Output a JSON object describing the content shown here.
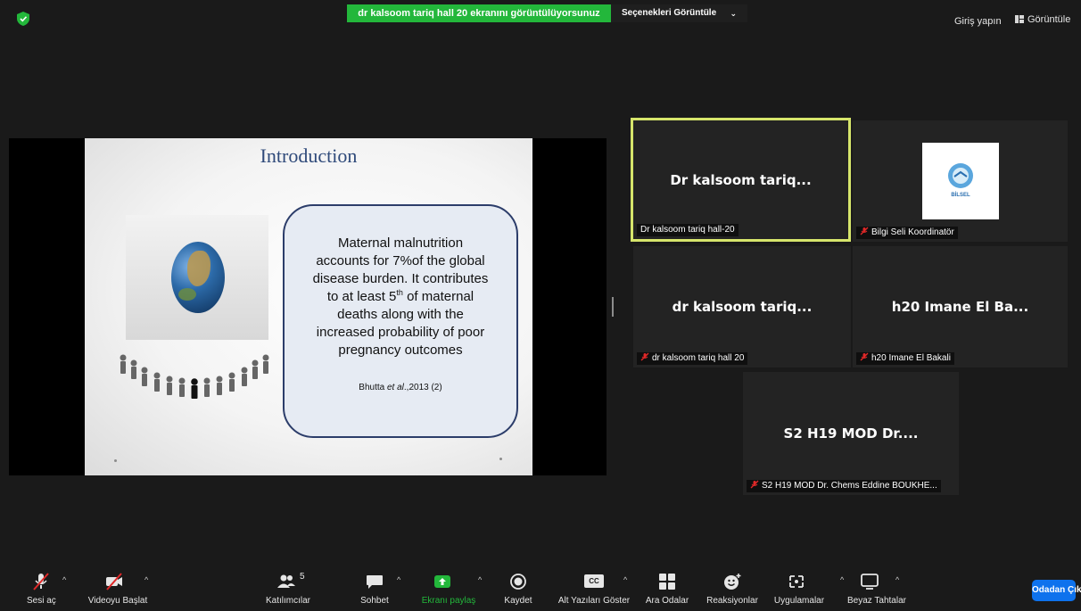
{
  "top_bar": {
    "share_banner": "dr kalsoom tariq hall  20 ekranını görüntülüyorsunuz",
    "view_options": "Seçenekleri Görüntüle",
    "sign_in": "Giriş yapın",
    "view": "Görüntüle",
    "colors": {
      "banner": "#23b73b",
      "shield": "#23b73b"
    }
  },
  "slide": {
    "title": "Introduction",
    "body_line1": "Maternal malnutrition",
    "body_line2": "accounts for 7%of the global",
    "body_line3": "disease burden.  It contributes",
    "body_line4_pre": "to at least  5",
    "body_line4_sup": "th",
    "body_line4_post": "  of maternal",
    "body_line5": "deaths along with the",
    "body_line6": "increased probability of poor",
    "body_line7": "pregnancy outcomes",
    "citation_pre": "Bhutta ",
    "citation_ital": "et al",
    "citation_post": ".,2013 (2)"
  },
  "participants": [
    {
      "display_name": "Dr kalsoom tariq...",
      "label": "Dr kalsoom tariq hall-20",
      "muted": false,
      "active_speaker": true
    },
    {
      "display_name": "",
      "label": "Bilgi Seli Koordinatör",
      "muted": true,
      "logo_text": "BİLSEL"
    },
    {
      "display_name": "dr kalsoom tariq...",
      "label": "dr kalsoom tariq hall  20",
      "muted": true
    },
    {
      "display_name": "h20 Imane El Ba...",
      "label": "h20 Imane El Bakali",
      "muted": true
    },
    {
      "display_name": "S2 H19 MOD Dr....",
      "label": "S2 H19 MOD Dr. Chems Eddine BOUKHE...",
      "muted": true
    }
  ],
  "toolbar": {
    "unmute": "Sesi aç",
    "start_video": "Videoyu Başlat",
    "participants": "Katılımcılar",
    "participants_count": "5",
    "chat": "Sohbet",
    "share_screen": "Ekranı paylaş",
    "record": "Kaydet",
    "captions": "Alt Yazıları Göster",
    "cc": "CC",
    "breakout_rooms": "Ara Odalar",
    "reactions": "Reaksiyonlar",
    "apps": "Uygulamalar",
    "whiteboards": "Beyaz Tahtalar",
    "leave": "Odadan Çık",
    "colors": {
      "leave": "#0e72ed",
      "share": "#23b73b",
      "muted": "#e02828"
    }
  }
}
